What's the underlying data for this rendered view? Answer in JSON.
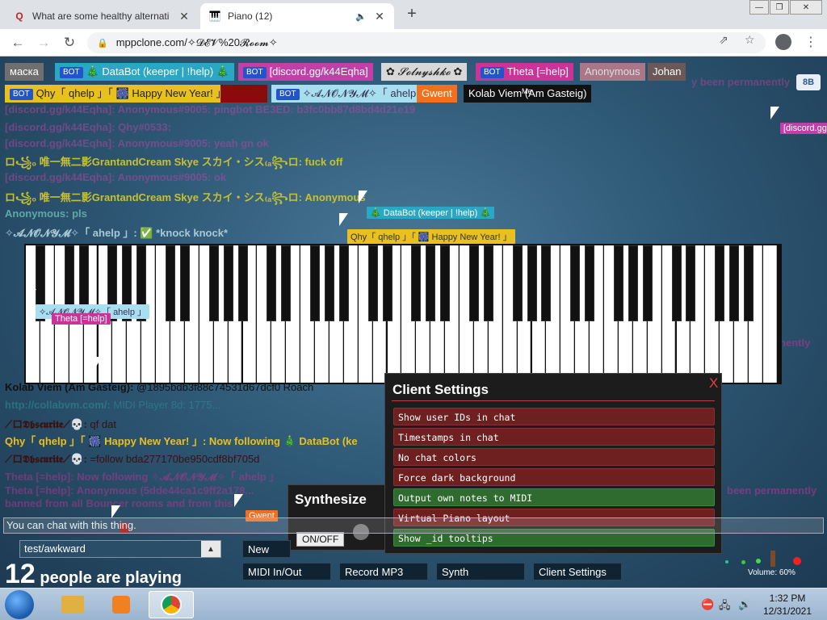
{
  "browser": {
    "tabs": [
      {
        "title": "What are some healthy alternati",
        "favicon": "quora-icon",
        "active": false
      },
      {
        "title": "Piano (12)",
        "favicon": "piano-icon",
        "active": true,
        "playing_audio": true
      }
    ],
    "url": "mppclone.com/✧𝓓𝓔𝓥%20𝓡𝓸𝓸𝓶✧"
  },
  "users": [
    {
      "name": "маска",
      "bot": false,
      "color": "#6f6f6f"
    },
    {
      "name": "🎄 DataBot (keeper | !help) 🎄",
      "bot": true,
      "color": "#2aa7c5"
    },
    {
      "name": "[discord.gg/k44Eqha]",
      "bot": true,
      "color": "#c040a8"
    },
    {
      "name": "✿ 𝓢𝓸𝓵𝓷𝔂𝓼𝓱𝓴𝓸 ✿",
      "bot": false,
      "color": "#d8d8d8"
    },
    {
      "name": "Theta [=help]",
      "bot": true,
      "color": "#cc3399"
    },
    {
      "name": "Anonymous",
      "bot": false,
      "color": "#aa7788"
    },
    {
      "name": "Johan",
      "bot": false,
      "color": "#6b5858"
    },
    {
      "name": "Qhy「 qhelp 」「 🎆 Happy New Year! 」",
      "bot": true,
      "color": "#e8c020"
    },
    {
      "name": "",
      "bot": false,
      "color": "#8b0a0a"
    },
    {
      "name": "✧𝓐𝓝𝓞𝓝𝓨𝓜✧「 ahelp 」",
      "bot": true,
      "color": "#a8dff0"
    },
    {
      "name": "Gwent",
      "bot": false,
      "color": "#f07020"
    },
    {
      "name": "Kolab Viem (Am Gasteig)",
      "bot": false,
      "color": "#111111"
    }
  ],
  "me_label": "Me",
  "bot_label": "BOT",
  "user_id_badge": "8B",
  "chat": [
    {
      "author": "[discord.gg/k44Eqha]:",
      "text": "Anonymous#9005: pingbot BE3ED: b3fc0bb87d8bd4d21e19",
      "color": "#cc44aa",
      "dim": true
    },
    {
      "author": "[discord.gg/k44Eqha]:",
      "text": "Qhy#0533:",
      "color": "#cc44aa",
      "dim": true
    },
    {
      "author": "[discord.gg/k44Eqha]:",
      "text": "Anonymous#9005: yeah gn ok",
      "color": "#cc44aa",
      "dim": true
    },
    {
      "author": "ロ꧁₀ 唯一無二影GrantandCream Skye スカイ・シス₍ₐ꧂ロ:",
      "text": "fuck off",
      "color": "#c8c030",
      "dim": false
    },
    {
      "author": "[discord.gg/k44Eqha]:",
      "text": "Anonymous#9005: ok",
      "color": "#cc44aa",
      "dim": true
    },
    {
      "author": "ロ꧁₀ 唯一無二影GrantandCream Skye スカイ・シス₍ₐ꧂ロ:",
      "text": "Anonymous",
      "color": "#c8c030",
      "dim": false
    },
    {
      "author": "Anonymous:",
      "text": "pls",
      "color": "#5fa8a8",
      "dim": false
    },
    {
      "author": "✧𝓐𝓝𝓞𝓝𝓨𝓜✧「 ahelp 」:",
      "text": "✅ *knock knock*",
      "color": "#a8c8d8",
      "dim": false
    },
    {
      "author": "Kolab Viem (Am Gasteig):",
      "text": "@1895bdb3f88c74531d67dcf0 Roach",
      "color": "#111111",
      "dim": false
    },
    {
      "author": "http://collabvm.com/:",
      "text": "MIDI Player 8d: 1775...",
      "color": "#30a0a0",
      "dim": true
    },
    {
      "author": "⟋ロ𝕯𝖇𝖘𝖈𝖚𝖗𝖎𝖙𝖊⟋💀:",
      "text": "qf dat",
      "color": "#3a1010",
      "dim": false
    },
    {
      "author": "Qhy「 qhelp 」「 🎆 Happy New Year! 」:",
      "text": "Now following 🎄 DataBot (ke",
      "color": "#e8c020",
      "dim": false
    },
    {
      "author": "⟋ロ𝕯𝖇𝖘𝖈𝖚𝖗𝖎𝖙𝖊⟋💀:",
      "text": "=follow bda277170be950cdf8bf705d",
      "color": "#3a1010",
      "dim": false
    },
    {
      "author": "Theta [=help]:",
      "text": "Now following ✧𝓐𝓝𝓞𝓝𝓨𝓜✧「 ahelp 」",
      "color": "#cc3399",
      "dim": true
    },
    {
      "author": "Theta [=help]:",
      "text": "Anonymous (5dde44ca1c9ff2a178...",
      "color": "#cc3399",
      "dim": true
    },
    {
      "author": "",
      "text": "banned from all Bouncer rooms and from this",
      "color": "#cc3399",
      "dim": true
    }
  ],
  "chat_right_fragments": [
    "y been permanently",
    "een permanently",
    "been permanently"
  ],
  "chat_input": "You can chat with this thing.",
  "cursor_tags": [
    {
      "label": "🎄 DataBot (keeper | !help) 🎄",
      "color": "#2aa7c5"
    },
    {
      "label": "Qhy「 qhelp 」「 🎆 Happy New Year! 」",
      "color": "#e8c020"
    },
    {
      "label": "✧𝓐𝓝𝓞𝓝𝓨𝓜✧「 ahelp 」",
      "color": "#a8dff0"
    },
    {
      "label": "Theta [=help]",
      "color": "#cc3399"
    },
    {
      "label": "Gwent",
      "color": "#f07020"
    },
    {
      "label": "[discord.gg",
      "color": "#c040a8"
    }
  ],
  "client_settings": {
    "title": "Client Settings",
    "close": "X",
    "options": [
      {
        "label": "Show user IDs in chat",
        "enabled": false
      },
      {
        "label": "Timestamps in chat",
        "enabled": false
      },
      {
        "label": "No chat colors",
        "enabled": false
      },
      {
        "label": "Force dark background",
        "enabled": false
      },
      {
        "label": "Output own notes to MIDI",
        "enabled": true
      },
      {
        "label": "Virtual Piano layout",
        "enabled": false
      },
      {
        "label": "Show _id tooltips",
        "enabled": true
      }
    ]
  },
  "synth": {
    "title": "Synthesize",
    "onoff": "ON/OFF"
  },
  "room": {
    "value": "test/awkward"
  },
  "players": {
    "count": "12",
    "label": "people are playing"
  },
  "controls": [
    "New Room...",
    "MIDI In/Out",
    "Record MP3",
    "Synth",
    "Client Settings"
  ],
  "volume": "Volume: 60%",
  "clock": {
    "time": "1:32 PM",
    "date": "12/31/2021"
  }
}
